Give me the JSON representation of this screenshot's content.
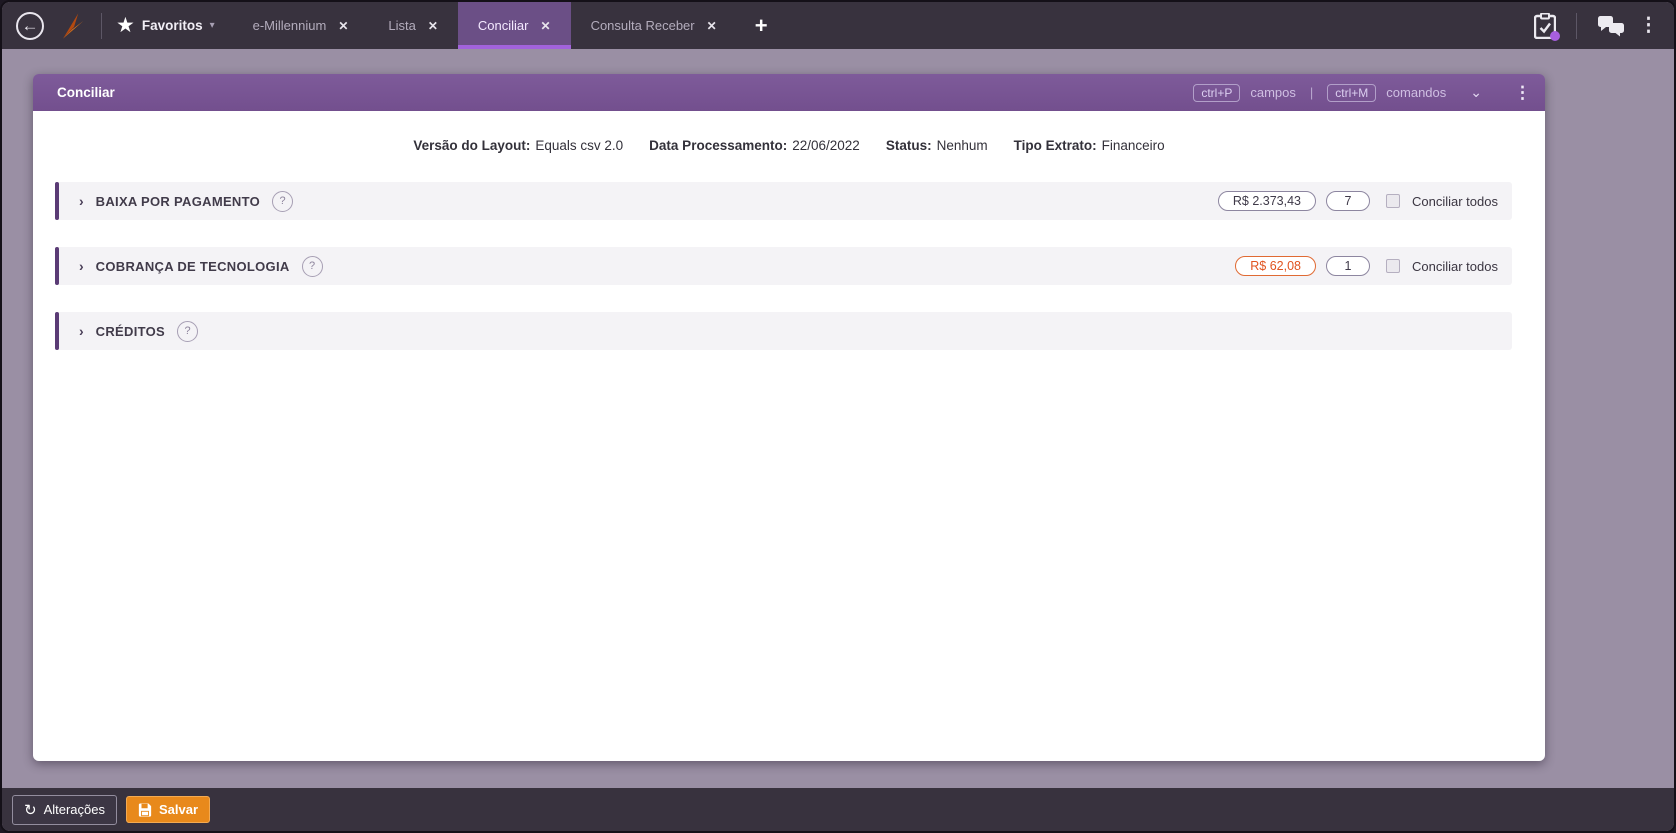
{
  "topbar": {
    "favorites_label": "Favoritos",
    "tabs": [
      {
        "label": "e-Millennium",
        "active": false
      },
      {
        "label": "Lista",
        "active": false
      },
      {
        "label": "Conciliar",
        "active": true
      },
      {
        "label": "Consulta Receber",
        "active": false
      }
    ],
    "new_tab_label": "+",
    "icons": {
      "back": "←",
      "star": "★",
      "favorites_caret": "▾",
      "tab_close": "✕",
      "tasks": "clipboard-check-icon",
      "chat": "chat-bubbles-icon",
      "overflow_menu": "⋮"
    }
  },
  "window": {
    "title": "Conciliar",
    "shortcuts": {
      "fields_key": "ctrl+P",
      "fields_label": "campos",
      "separator": "|",
      "commands_key": "ctrl+M",
      "commands_label": "comandos"
    },
    "icons": {
      "collapse_chevron": "⌄",
      "overflow_menu": "⋮"
    }
  },
  "header_info": [
    {
      "label": "Versão do Layout:",
      "value": "Equals csv 2.0"
    },
    {
      "label": "Data Processamento:",
      "value": "22/06/2022"
    },
    {
      "label": "Status:",
      "value": "Nenhum"
    },
    {
      "label": "Tipo Extrato:",
      "value": "Financeiro"
    }
  ],
  "sections": [
    {
      "label": "BAIXA POR PAGAMENTO",
      "help": "?",
      "expand_chevron": "›",
      "amount": "R$ 2.373,43",
      "count": "7",
      "checkbox_label": "Conciliar todos",
      "checkbox_checked": false
    },
    {
      "label": "COBRANÇA DE TECNOLOGIA",
      "help": "?",
      "expand_chevron": "›",
      "amount": "R$ 62,08",
      "count": "1",
      "checkbox_label": "Conciliar todos",
      "checkbox_checked": false
    },
    {
      "label": "CRÉDITOS",
      "help": "?",
      "expand_chevron": "›"
    }
  ],
  "footer": {
    "changes_label": "Alterações",
    "changes_icon": "↺",
    "save_label": "Salvar",
    "save_icon": "floppy-disk-icon"
  },
  "colors": {
    "topbar_bg": "#38323e",
    "active_tab_bg": "#6b4f86",
    "active_tab_underline": "#a263dc",
    "desktop_bg": "#9a8fa4",
    "window_titlebar": "#7a5796",
    "section_accent": "#5a3b75",
    "section_bg": "#f4f3f6",
    "alert_amount": "#e0531f",
    "save_button": "#e8891b",
    "notification_dot": "#a85fe0"
  }
}
